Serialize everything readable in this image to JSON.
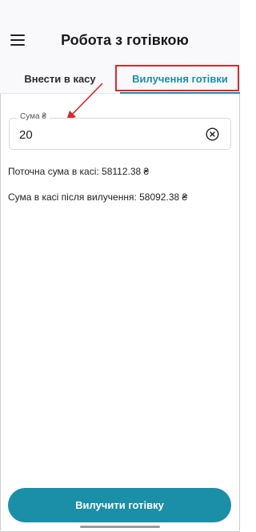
{
  "header": {
    "title": "Робота з готівкою",
    "menu_icon": "hamburger-menu-icon"
  },
  "tabs": [
    {
      "label": "Внести в касу",
      "active": false
    },
    {
      "label": "Вилучення готівки",
      "active": true
    }
  ],
  "amount_field": {
    "label": "Сума ₴",
    "value": "20",
    "clear_icon": "clear-circle-x-icon"
  },
  "info": {
    "current": "Поточна сума в касі: 58112.38 ₴",
    "after": "Сума в касі після вилучення: 58092.38 ₴"
  },
  "action_button": {
    "label": "Вилучити готівку"
  },
  "colors": {
    "accent": "#1c8fa8",
    "highlight": "#e0262b"
  }
}
